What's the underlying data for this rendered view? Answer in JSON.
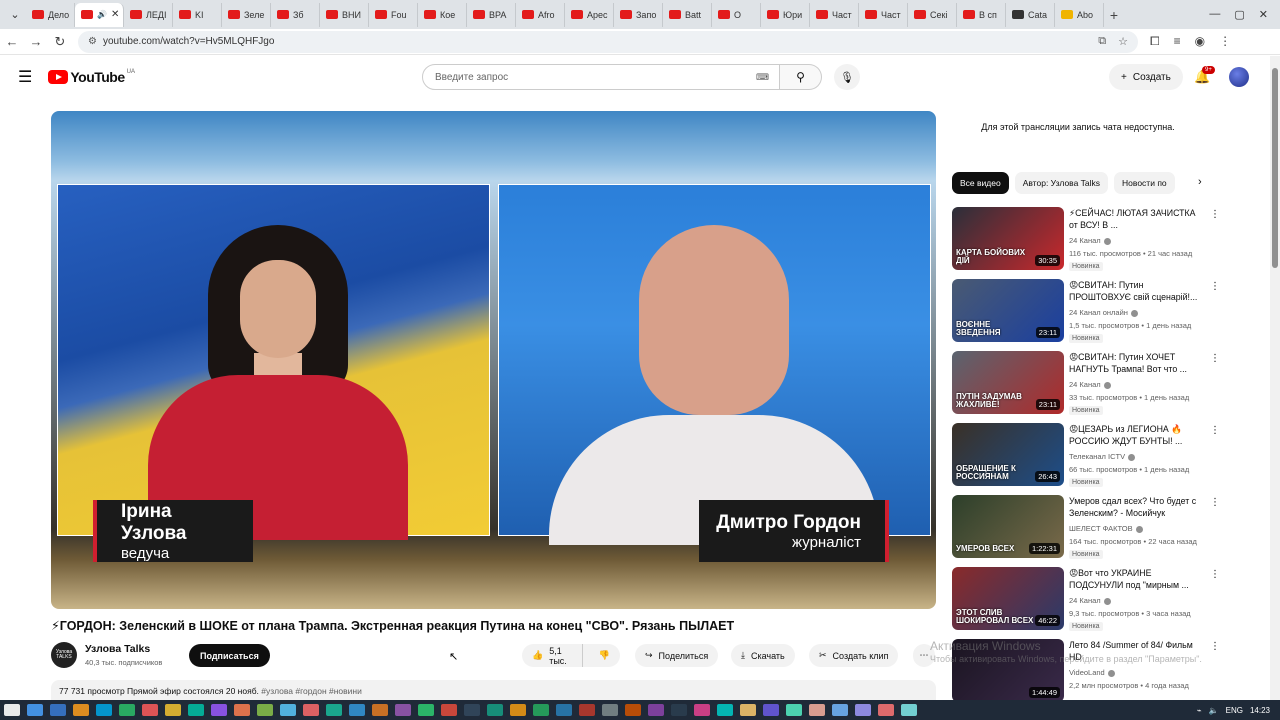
{
  "browser": {
    "tabs": [
      {
        "label": "Дело",
        "fav": "red"
      },
      {
        "label": "",
        "fav": "red",
        "active": true
      },
      {
        "label": "ЛЕДІ",
        "fav": "red"
      },
      {
        "label": "KI",
        "fav": "red"
      },
      {
        "label": "Зеле",
        "fav": "red"
      },
      {
        "label": "Зб",
        "fav": "red"
      },
      {
        "label": "ВНИ",
        "fav": "red"
      },
      {
        "label": "Fou",
        "fav": "red"
      },
      {
        "label": "Кое",
        "fav": "red"
      },
      {
        "label": "ВРА",
        "fav": "red"
      },
      {
        "label": "Afro",
        "fav": "red"
      },
      {
        "label": "Арес",
        "fav": "red"
      },
      {
        "label": "Запо",
        "fav": "red"
      },
      {
        "label": "Batt",
        "fav": "red"
      },
      {
        "label": "О",
        "fav": "red"
      },
      {
        "label": "Юри",
        "fav": "red"
      },
      {
        "label": "Част",
        "fav": "red"
      },
      {
        "label": "Част",
        "fav": "red"
      },
      {
        "label": "Секі",
        "fav": "red"
      },
      {
        "label": "В сп",
        "fav": "red"
      },
      {
        "label": "Cata",
        "fav": "dark"
      },
      {
        "label": "Abo",
        "fav": "yellow"
      }
    ],
    "new_tab": "+",
    "url": "youtube.com/watch?v=Hv5MLQHFJgo"
  },
  "header": {
    "logo_text": "YouTube",
    "region": "UA",
    "search_placeholder": "Введите запрос",
    "create_label": "Создать",
    "notifications_count": "9+"
  },
  "player": {
    "left_name": "Ірина Узлова",
    "left_role": "ведуча",
    "right_name": "Дмитро Гордон",
    "right_role": "журналіст"
  },
  "video": {
    "title": "⚡ГОРДОН: Зеленский в ШОКЕ от плана Трампа. Экстренная реакция Путина на конец \"СВО\". Рязань ПЫЛАЕТ",
    "channel_name": "Узлова Talks",
    "channel_avatar_text": "Узлова TALKS",
    "subscribers": "40,3 тыс. подписчиков",
    "subscribe_label": "Подписаться",
    "likes": "5,1 тыс.",
    "share_label": "Поделиться",
    "download_label": "Скачать",
    "clip_label": "Создать клип",
    "description_line": "77 731 просмотр  Прямой эфир состоялся 20 нояб.",
    "tags": "#узлова #гордон #новини"
  },
  "sidebar": {
    "chat_note": "Для этой трансляции запись чата недоступна.",
    "chips": [
      "Все видео",
      "Автор: Узлова Talks",
      "Новости по"
    ],
    "recommendations": [
      {
        "title": "⚡СЕЙЧАС! ЛЮТАЯ ЗАЧИСТКА от ВСУ! В ...",
        "channel": "24 Канал",
        "meta": "116 тыс. просмотров • 21 час назад",
        "badge": "Новинка",
        "duration": "30:35",
        "thumb_text": "КАРТА БОЙОВИХ ДІЙ",
        "thumb_colors": [
          "#2a2f3a",
          "#c9282c"
        ]
      },
      {
        "title": "😡СВИТАН: Путин ПРОШТОВХУЄ свій сценарій!...",
        "channel": "24 Канал онлайн",
        "meta": "1,5 тыс. просмотров • 1 день назад",
        "badge": "Новинка",
        "duration": "23:11",
        "thumb_text": "ВОЄННЕ ЗВЕДЕННЯ",
        "thumb_colors": [
          "#4a5a72",
          "#1a3fa0"
        ]
      },
      {
        "title": "😡СВИТАН: Путин ХОЧЕТ НАГНУТЬ Трампа! Вот что ...",
        "channel": "24 Канал",
        "meta": "33 тыс. просмотров • 1 день назад",
        "badge": "Новинка",
        "duration": "23:11",
        "thumb_text": "ПУТІН ЗАДУМАВ ЖАХЛИВЕ!",
        "thumb_colors": [
          "#5a6470",
          "#b02a2a"
        ]
      },
      {
        "title": "😡ЦЕЗАРЬ из ЛЕГИОНА 🔥 РОССИЮ ЖДУТ БУНТЫ! ...",
        "channel": "Телеканал ICTV",
        "meta": "66 тыс. просмотров • 1 день назад",
        "badge": "Новинка",
        "duration": "26:43",
        "thumb_text": "ОБРАЩЕНИЕ К РОССИЯНАМ",
        "thumb_colors": [
          "#3a3026",
          "#1d4e8a"
        ]
      },
      {
        "title": "Умеров сдал всех? Что будет с Зеленским? - Мосийчук",
        "channel": "ШЕЛЕСТ ФАКТОВ",
        "meta": "164 тыс. просмотров • 22 часа назад",
        "badge": "Новинка",
        "duration": "1:22:31",
        "thumb_text": "УМЕРОВ ВСЕХ",
        "thumb_colors": [
          "#2c3f2a",
          "#7a6a4a"
        ]
      },
      {
        "title": "😡Вот что УКРАИНЕ ПОДСУНУЛИ под \"мирным ...",
        "channel": "24 Канал",
        "meta": "9,3 тыс. просмотров • 3 часа назад",
        "badge": "Новинка",
        "duration": "46:22",
        "thumb_text": "ЭТОТ СЛИВ ШОКИРОВАЛ ВСЕХ",
        "thumb_colors": [
          "#8a2a2a",
          "#2a3a6a"
        ]
      },
      {
        "title": "Лето 84 /Summer of 84/ Фильм HD",
        "channel": "VideoLand",
        "meta": "2,2 млн просмотров • 4 года назад",
        "badge": "",
        "duration": "1:44:49",
        "thumb_text": "",
        "thumb_colors": [
          "#1a1420",
          "#3a2a4a"
        ]
      }
    ],
    "activate_windows": "Активация Windows",
    "activate_windows_sub": "Чтобы активировать Windows, перейдите в раздел \"Параметры\"."
  },
  "taskbar": {
    "lang": "ENG",
    "time": "14:23"
  }
}
